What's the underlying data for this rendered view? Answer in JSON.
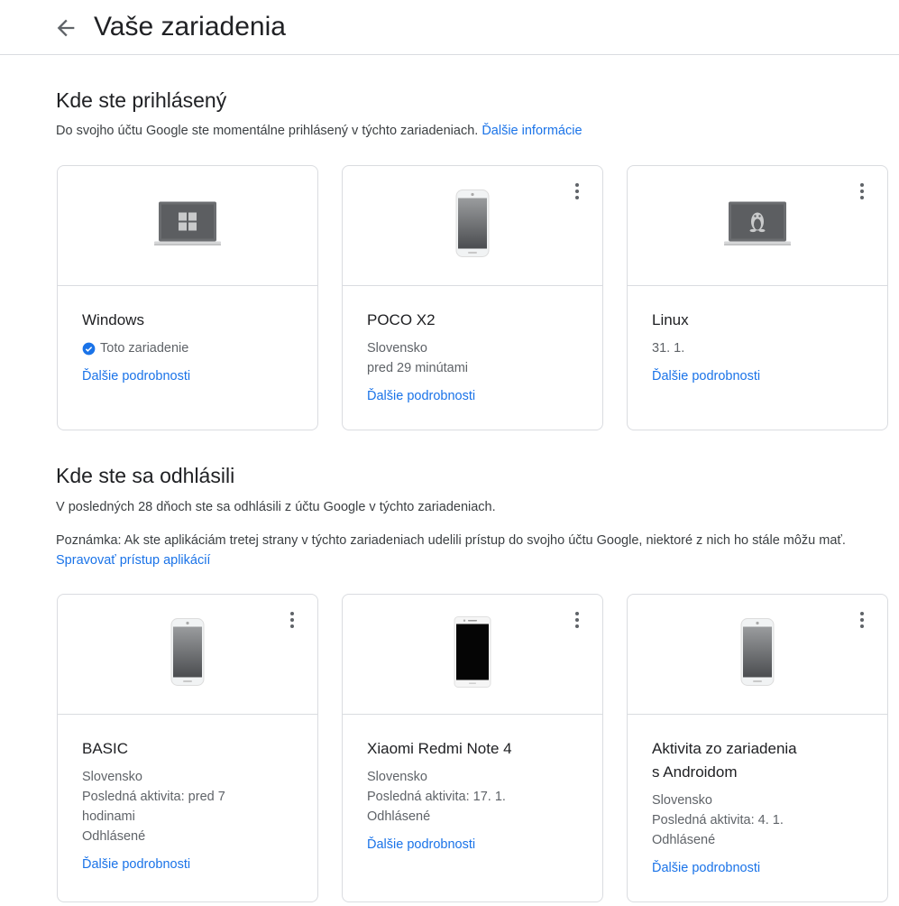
{
  "header": {
    "title": "Vaše zariadenia"
  },
  "signed_in": {
    "title": "Kde ste prihlásený",
    "description": "Do svojho účtu Google ste momentálne prihlásený v týchto zariadeniach.",
    "more_info_link": "Ďalšie informácie",
    "devices": [
      {
        "name": "Windows",
        "status": "Toto zariadenie",
        "link": "Ďalšie podrobnosti",
        "icon": "windows-laptop-icon"
      },
      {
        "name": "POCO X2",
        "location": "Slovensko",
        "time": "pred 29 minútami",
        "link": "Ďalšie podrobnosti",
        "icon": "phone-icon"
      },
      {
        "name": "Linux",
        "date": "31. 1.",
        "link": "Ďalšie podrobnosti",
        "icon": "linux-laptop-icon"
      }
    ]
  },
  "signed_out": {
    "title": "Kde ste sa odhlásili",
    "description": "V posledných 28 dňoch ste sa odhlásili z účtu Google v týchto zariadeniach.",
    "note": "Poznámka: Ak ste aplikáciám tretej strany v týchto zariadeniach udelili prístup do svojho účtu Google, niektoré z nich ho stále môžu mať.",
    "manage_link": "Spravovať prístup aplikácií",
    "devices": [
      {
        "name": "BASIC",
        "location": "Slovensko",
        "activity_line1": "Posledná aktivita: pred 7",
        "activity_line2": "hodinami",
        "status": "Odhlásené",
        "link": "Ďalšie podrobnosti",
        "icon": "phone-icon"
      },
      {
        "name": "Xiaomi Redmi Note 4",
        "location": "Slovensko",
        "activity": "Posledná aktivita: 17. 1.",
        "status": "Odhlásené",
        "link": "Ďalšie podrobnosti",
        "icon": "phone-black-screen-icon"
      },
      {
        "name_line1": "Aktivita zo zariadenia",
        "name_line2": "s Androidom",
        "location": "Slovensko",
        "activity": "Posledná aktivita: 4. 1.",
        "status": "Odhlásené",
        "link": "Ďalšie podrobnosti",
        "icon": "phone-icon"
      }
    ]
  },
  "colors": {
    "link": "#1a73e8",
    "border": "#dadce0",
    "text_primary": "#202124",
    "text_secondary": "#5f6368"
  }
}
